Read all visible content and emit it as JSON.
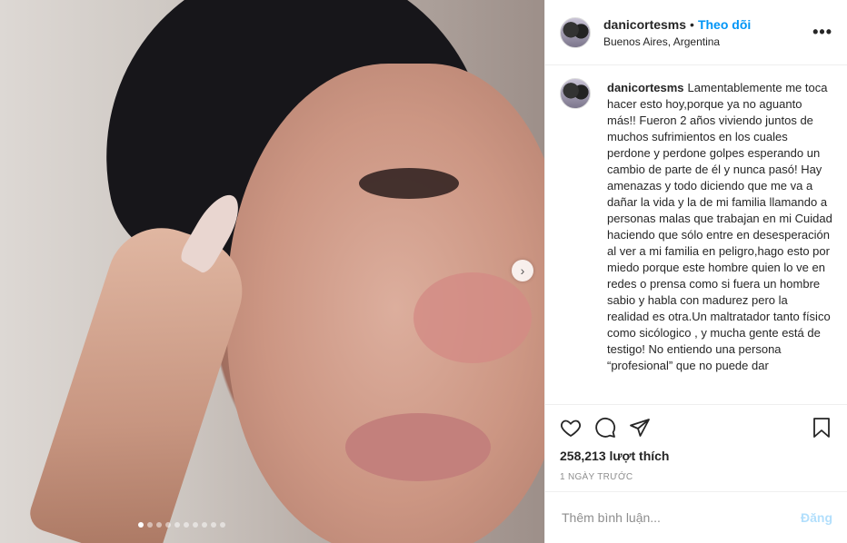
{
  "post": {
    "username": "danicortesms",
    "follow_label": "Theo dõi",
    "separator": "•",
    "location": "Buenos Aires, Argentina",
    "more_label": "•••",
    "caption": "Lamentablemente me toca hacer esto hoy,porque ya no aguanto más!! Fueron 2 años viviendo juntos de muchos sufrimientos en los cuales perdone y perdone golpes esperando un cambio de parte de él y nunca pasó! Hay amenazas y todo diciendo que me va a dañar la vida y la de mi familia llamando a personas malas que trabajan en mi Cuidad haciendo que sólo entre en desesperación al ver a mi familia en peligro,hago esto por miedo porque este hombre quien lo ve en redes o prensa como si fuera un hombre sabio y habla con madurez pero la realidad es otra.Un maltratador tanto físico como sicólogico , y mucha gente está de testigo! No entiendo una persona “profesional” que no puede dar",
    "likes": "258,213 lượt thích",
    "time_ago": "1 NGÀY TRƯỚC",
    "comment_placeholder": "Thêm bình luận...",
    "post_button": "Đăng"
  },
  "media": {
    "next_icon": "›",
    "carousel_total": 10,
    "carousel_active": 1
  },
  "icons": [
    "heart-icon",
    "comment-icon",
    "share-icon",
    "bookmark-icon"
  ],
  "colors": {
    "accent": "#0095f6",
    "post_button_disabled": "#b2dffc",
    "muted": "#8e8e8e"
  }
}
